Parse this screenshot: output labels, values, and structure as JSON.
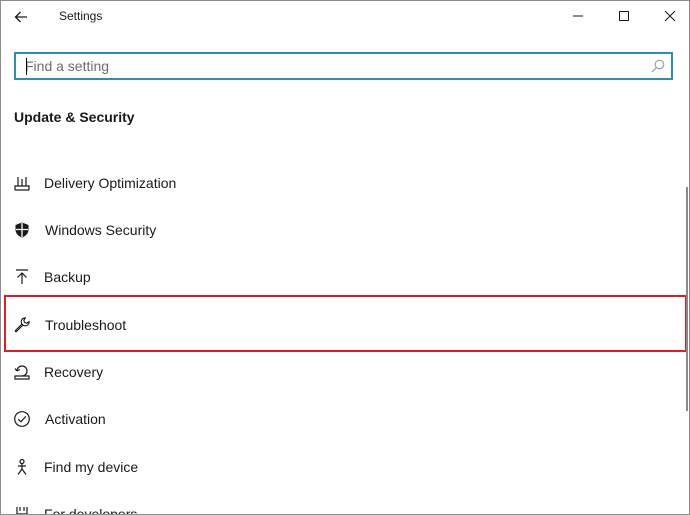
{
  "window": {
    "title": "Settings"
  },
  "search": {
    "placeholder": "Find a setting"
  },
  "section": {
    "title": "Update & Security"
  },
  "nav": {
    "items": [
      {
        "label": "Delivery Optimization",
        "icon": "delivery-optimization-icon"
      },
      {
        "label": "Windows Security",
        "icon": "shield-icon"
      },
      {
        "label": "Backup",
        "icon": "backup-icon"
      },
      {
        "label": "Troubleshoot",
        "icon": "wrench-icon",
        "highlighted": true
      },
      {
        "label": "Recovery",
        "icon": "recovery-icon"
      },
      {
        "label": "Activation",
        "icon": "activation-check-icon"
      },
      {
        "label": "Find my device",
        "icon": "find-device-icon"
      },
      {
        "label": "For developers",
        "icon": "developer-icon"
      }
    ]
  },
  "colors": {
    "search_border": "#2b8fb0",
    "highlight_border": "#d6202a"
  }
}
